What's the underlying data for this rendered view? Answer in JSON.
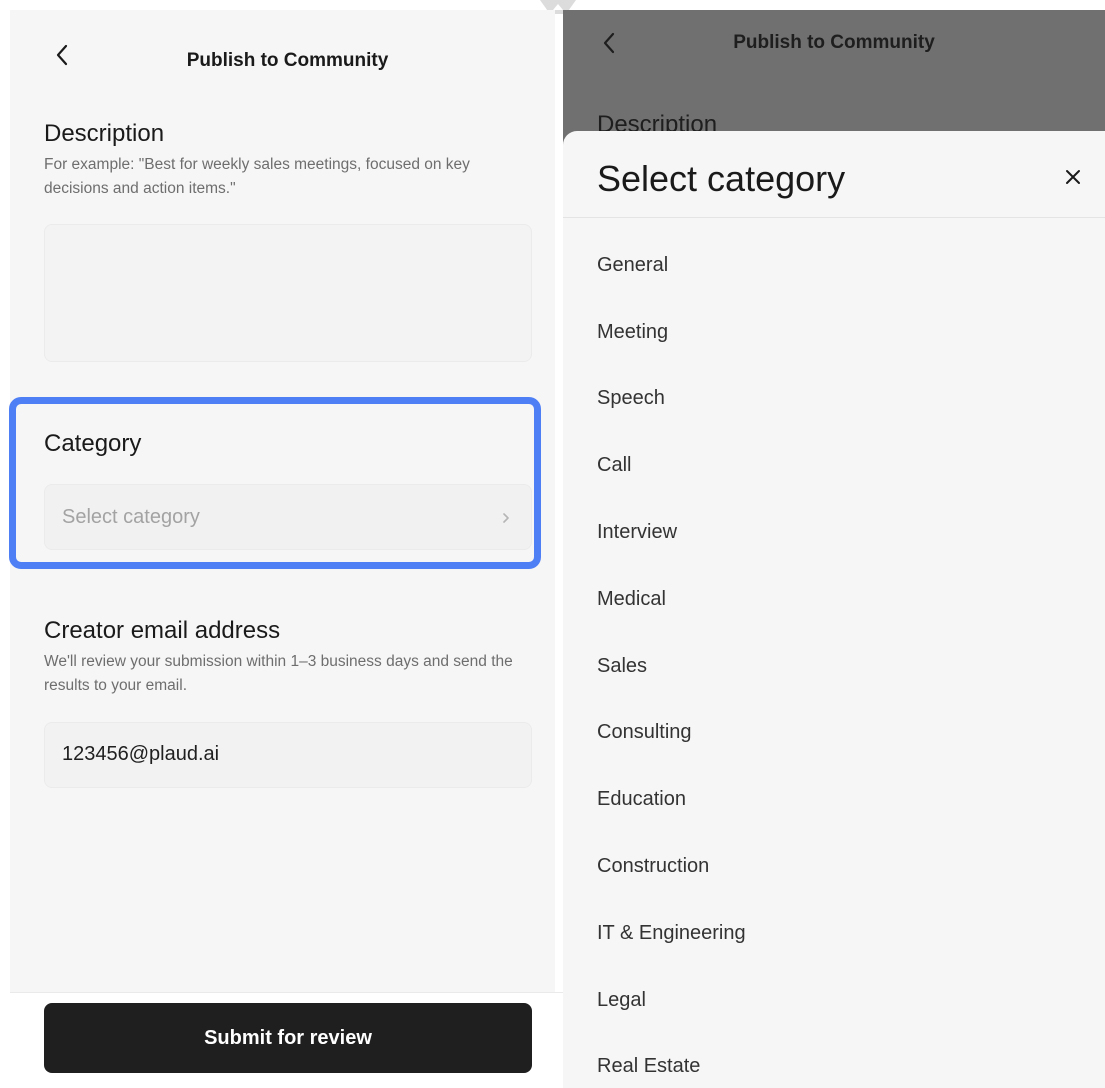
{
  "left_screen": {
    "header": {
      "title": "Publish to Community"
    },
    "description": {
      "title": "Description",
      "hint": "For example: \"Best for weekly sales meetings, focused on key decisions and action items.\"",
      "value": ""
    },
    "category": {
      "title": "Category",
      "placeholder": "Select category"
    },
    "email": {
      "title": "Creator email address",
      "hint": "We'll review your submission within 1–3 business days and send the results to your email.",
      "value": "123456@plaud.ai"
    },
    "submit_label": "Submit for review"
  },
  "right_screen": {
    "header": {
      "title": "Publish to Community"
    },
    "background_section_title": "Description",
    "sheet": {
      "title": "Select category",
      "items": [
        "General",
        "Meeting",
        "Speech",
        "Call",
        "Interview",
        "Medical",
        "Sales",
        "Consulting",
        "Education",
        "Construction",
        "IT & Engineering",
        "Legal",
        "Real Estate"
      ]
    }
  },
  "colors": {
    "highlight": "#4f7ff5",
    "submit_bg": "#1f1f1f",
    "overlay": "#707070"
  },
  "icons": [
    "chevron-left-icon",
    "chevron-right-icon",
    "close-icon"
  ]
}
